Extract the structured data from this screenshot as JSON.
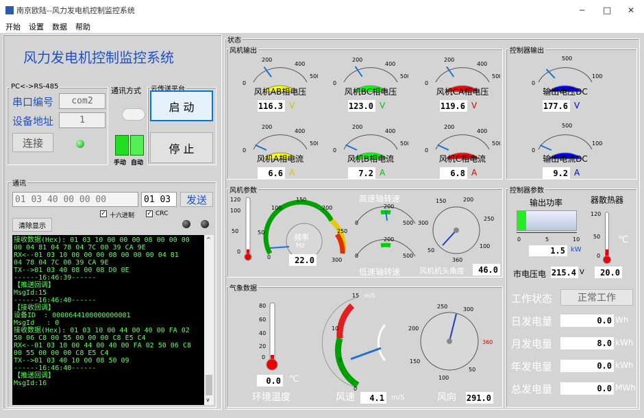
{
  "window": {
    "title": "南京欧陆--风力发电机控制监控系统",
    "min": "─",
    "max": "□",
    "close": "✕"
  },
  "menu": [
    "开始",
    "设置",
    "数据",
    "帮助"
  ],
  "left": {
    "app_title": "风力发电机控制监控系统",
    "serial_group": "PC<->RS-485",
    "port_label": "串口编号",
    "port_value": "com2",
    "addr_label": "设备地址",
    "addr_value": "1",
    "connect": "连接",
    "comm_mode_label": "通讯方式",
    "manual": "手动",
    "auto": "自动",
    "cloud_label": "云传送平台",
    "start": "启 动",
    "stop": "停 止",
    "comm_group": "通讯",
    "send_input": "01 03 40 00 00 00",
    "crc_input": "01 03",
    "send": "发送",
    "hex_check": "十六进制",
    "crc_check": "CRC",
    "clear": "清除显示",
    "console": "接收数据(Hex): 01 03 10 00 00 00 08 00 00 00\n00 04 81 04 78 04 7C 00 39 CA 9E\nRX<--01 03 10 00 00 00 08 00 00 00 04 81\n04 78 04 7C 00 39 CA 9E\nTX-->01 03 40 08 00 08 D0 0E\n------16:46:39------\n【推送回调】\nMsgId:15\n------16:46:40------\n【接收回调】\n设备ID  : 0000644100000000001\nMsgId   : 0\n接收数据(Hex): 01 03 10 00 44 00 40 00 FA 02\n50 06 C8 00 55 00 00 00 C8 E5 C4\nRX<--01 03 10 00 44 00 40 00 FA 02 50 06 C8\n00 55 00 00 00 C8 E5 C4\nTX-->01 03 40 10 00 08 50 09\n------16:46:40------\n【推送回调】\nMsgId:16"
  },
  "status": {
    "group": "状态",
    "wind_out": "风机输出",
    "ctrl_out": "控制器输出",
    "gauges": [
      {
        "label": "风机AB相电压",
        "value": "116.3",
        "unit": "V",
        "color": "#ffff00",
        "ucolor": "#d4c000",
        "max": 500,
        "v": 116.3,
        "ticks": [
          "0",
          "200",
          "400",
          "500"
        ]
      },
      {
        "label": "风机BC相电压",
        "value": "123.0",
        "unit": "V",
        "color": "#00ff00",
        "ucolor": "#00c000",
        "max": 500,
        "v": 123.0,
        "ticks": [
          "0",
          "200",
          "400",
          "500"
        ]
      },
      {
        "label": "风机CA相电压",
        "value": "119.6",
        "unit": "V",
        "color": "#ff0000",
        "ucolor": "#e00000",
        "max": 500,
        "v": 119.6,
        "ticks": [
          "0",
          "200",
          "400",
          "500"
        ]
      },
      {
        "label": "风机A相电流",
        "value": "6.6",
        "unit": "A",
        "color": "#ffff00",
        "ucolor": "#d4c000",
        "max": 500,
        "v": 6.6,
        "ticks": [
          "0",
          "200",
          "400",
          "500"
        ]
      },
      {
        "label": "风机B相电流",
        "value": "7.2",
        "unit": "A",
        "color": "#00ff00",
        "ucolor": "#00c000",
        "max": 500,
        "v": 7.2,
        "ticks": [
          "0",
          "200",
          "400",
          "500"
        ]
      },
      {
        "label": "风机C相电流",
        "value": "6.8",
        "unit": "A",
        "color": "#ff0000",
        "ucolor": "#e00000",
        "max": 500,
        "v": 6.8,
        "ticks": [
          "0",
          "200",
          "400",
          "500"
        ]
      },
      {
        "label": "输出电压DC",
        "value": "177.6",
        "unit": "V",
        "color": "#0000ff",
        "ucolor": "#0000e0",
        "max": 1000,
        "v": 177.6,
        "ticks": [
          "0",
          "500",
          "1000"
        ]
      },
      {
        "label": "输出电流DC",
        "value": "9.2",
        "unit": "A",
        "color": "#0000ff",
        "ucolor": "#0000e0",
        "max": 1000,
        "v": 9.2,
        "ticks": [
          "0",
          "500",
          "1000"
        ]
      }
    ]
  },
  "params": {
    "group": "风机参数",
    "thermo_ticks": [
      "120",
      "100",
      "50",
      "0"
    ],
    "freq_label": "频率",
    "freq_unit": "Hz",
    "freq_value": "22.0",
    "freq_ticks": [
      "0",
      "50",
      "100",
      "150",
      "200",
      "250",
      "300"
    ],
    "high_shaft": "高速轴转速",
    "low_shaft": "低速轴转速",
    "shaft_ticks": [
      "0",
      "200",
      "500"
    ],
    "head_label": "风机机头角度",
    "head_value": "46.0",
    "head_ticks": [
      "150",
      "200",
      "250",
      "300",
      "360",
      "50",
      "100"
    ]
  },
  "ctrl": {
    "group": "控制器参数",
    "power_label": "输出功率",
    "power_value": "1.5",
    "power_unit": "kW",
    "power_ticks": [
      "0",
      "5",
      "10"
    ],
    "heat_label": "器散热器",
    "heat_ticks": [
      "120",
      "50",
      "0"
    ],
    "heat_unit": "℃",
    "heat_value": "20.0",
    "mains_label": "市电压电",
    "mains_value": "215.4",
    "mains_unit": "V",
    "work_label": "工作状态",
    "work_value": "正常工作",
    "rows": [
      {
        "label": "日发电量",
        "value": "0.0",
        "unit": "Wh"
      },
      {
        "label": "月发电量",
        "value": "8.0",
        "unit": "kWh"
      },
      {
        "label": "年发电量",
        "value": "0.0",
        "unit": "kWh"
      },
      {
        "label": "总发电量",
        "value": "0.0",
        "unit": "MWh"
      }
    ]
  },
  "weather": {
    "group": "气象数据",
    "temp_ticks": [
      "80",
      "60",
      "40",
      "20",
      "0"
    ],
    "temp_value": "0.0",
    "temp_unit": "℃",
    "temp_label": "环境温度",
    "wind_unit_top": "m/S",
    "wind_ticks": [
      "15",
      "10",
      "5",
      "0"
    ],
    "wind_label": "风速",
    "wind_value": "4.1",
    "wind_unit": "m/S",
    "dir_ticks": [
      "250",
      "300",
      "360",
      "200",
      "150",
      "100",
      "50"
    ],
    "dir_label": "风向",
    "dir_value": "291.0"
  }
}
